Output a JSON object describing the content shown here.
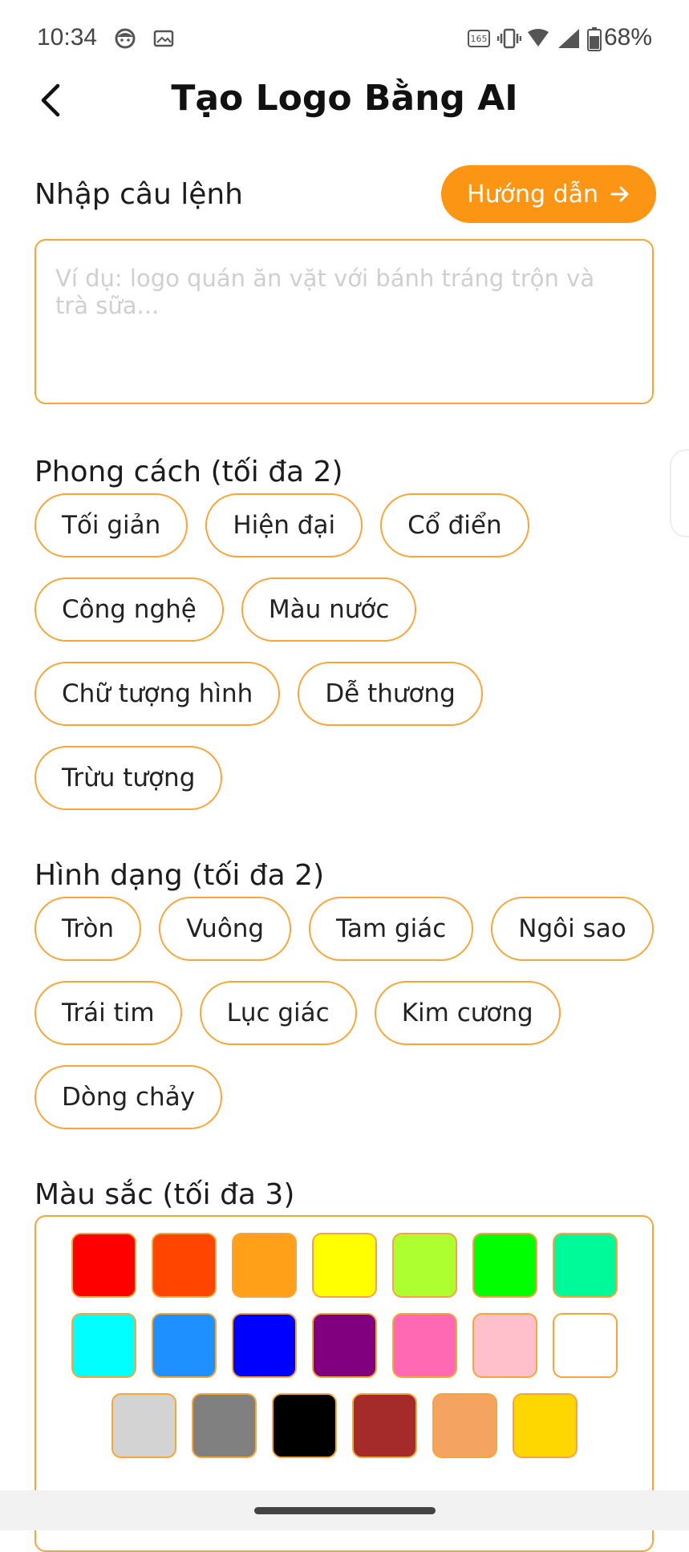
{
  "status_bar": {
    "time": "10:34",
    "battery": "68%",
    "icons": [
      "face-notification-icon",
      "image-notification-icon",
      "refresh-rate-icon",
      "vibrate-icon",
      "wifi-icon",
      "signal-icon",
      "battery-icon"
    ],
    "refresh_rate": "165"
  },
  "header": {
    "title": "Tạo Logo Bằng AI",
    "back_icon": "chevron-left-icon"
  },
  "prompt": {
    "label": "Nhập câu lệnh",
    "guide_button": "Hướng dẫn",
    "guide_icon": "arrow-right-icon",
    "value": "",
    "placeholder": "Ví dụ: logo quán ăn vặt với bánh tráng trộn và trà sữa..."
  },
  "style": {
    "label": "Phong cách (tối đa 2)",
    "options": [
      "Tối giản",
      "Hiện đại",
      "Cổ điển",
      "Công nghệ",
      "Màu nước",
      "Chữ tượng hình",
      "Dễ thương",
      "Trừu tượng"
    ]
  },
  "shape": {
    "label": "Hình dạng (tối đa 2)",
    "options": [
      "Tròn",
      "Vuông",
      "Tam giác",
      "Ngôi sao",
      "Trái tim",
      "Lục giác",
      "Kim cương",
      "Dòng chảy"
    ]
  },
  "colors": {
    "label": "Màu sắc (tối đa 3)",
    "swatches": [
      "#ff0000",
      "#ff4500",
      "#ffa018",
      "#ffff00",
      "#adff2f",
      "#00ff00",
      "#00fa9a",
      "#00ffff",
      "#1e90ff",
      "#0000ff",
      "#800080",
      "#ff69b4",
      "#ffc0cb",
      "#ffffff",
      "#d3d3d3",
      "#808080",
      "#000000",
      "#a52a2a",
      "#f4a460",
      "#ffd700"
    ]
  },
  "theme": {
    "accent": "#fd9514",
    "chip_border": "#f7a538"
  }
}
